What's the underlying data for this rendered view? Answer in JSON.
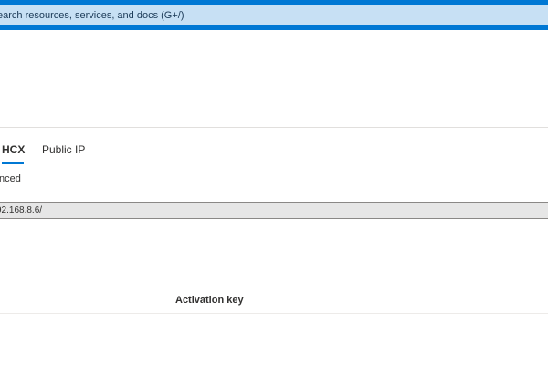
{
  "search": {
    "placeholder": "earch resources, services, and docs (G+/)"
  },
  "tabs": [
    {
      "label": "HCX",
      "active": true
    },
    {
      "label": "Public IP",
      "active": false
    }
  ],
  "section": {
    "subtext": "nced"
  },
  "url_field": {
    "value": "92.168.8.6/"
  },
  "table": {
    "columns": [
      "Activation key"
    ]
  },
  "colors": {
    "accent": "#0078d4",
    "search_background": "#c7e0f4",
    "field_background": "#e6e6e6"
  }
}
